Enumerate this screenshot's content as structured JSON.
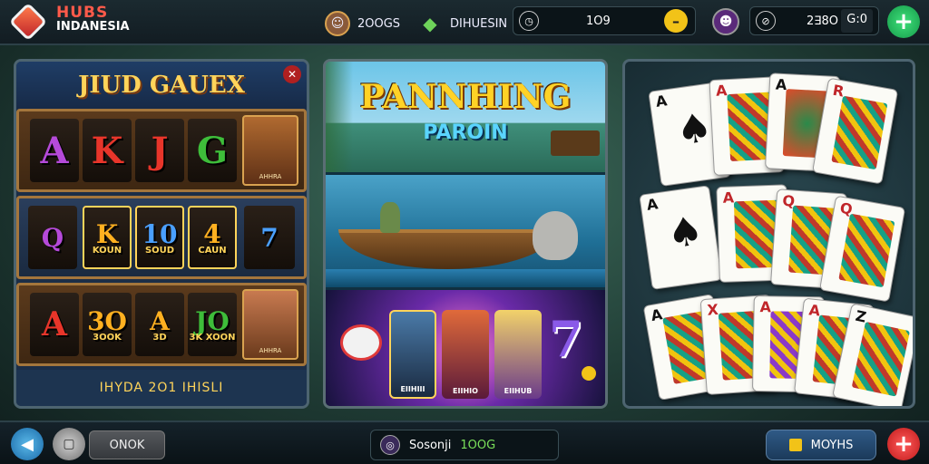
{
  "header": {
    "logo_line1": "HUBS",
    "logo_line2": "INDANESIA",
    "stat1_value": "2OOGS",
    "stat2_value": "DIHUESIN",
    "balance_value": "1O9",
    "score_value": "2∃8O",
    "score_extra": "G:0"
  },
  "panel_slots": {
    "title": "JIUD GAUEX",
    "row1": [
      "A",
      "K",
      "J",
      "G"
    ],
    "row2_syms": [
      "Q",
      "K",
      "10",
      "4",
      "7"
    ],
    "row2_labels": [
      "",
      "KOUN",
      "SOUD",
      "CAUN",
      ""
    ],
    "row3_syms": [
      "A",
      "3O",
      "A",
      "JO"
    ],
    "row3_labels": [
      "",
      "3OOK",
      "3D",
      "3K XOON"
    ],
    "portrait1_label": "AHHRA",
    "portrait2_label": "AHHRA",
    "footer": "IHYDA 2O1 IHISLI"
  },
  "panel_banners": {
    "title": "PANNHING",
    "subtitle": "PAROIN",
    "char_labels": [
      "EIIHIII",
      "EIIHIO",
      "EIIHUB"
    ]
  },
  "bottom": {
    "ok_label": "ONOK",
    "status_label": "Sosonji",
    "status_value": "1OOG",
    "moves_label": "MOYHS"
  },
  "colors": {
    "accent_green": "#2ecc71",
    "accent_red": "#e02a2a",
    "gold": "#ffd45a"
  }
}
